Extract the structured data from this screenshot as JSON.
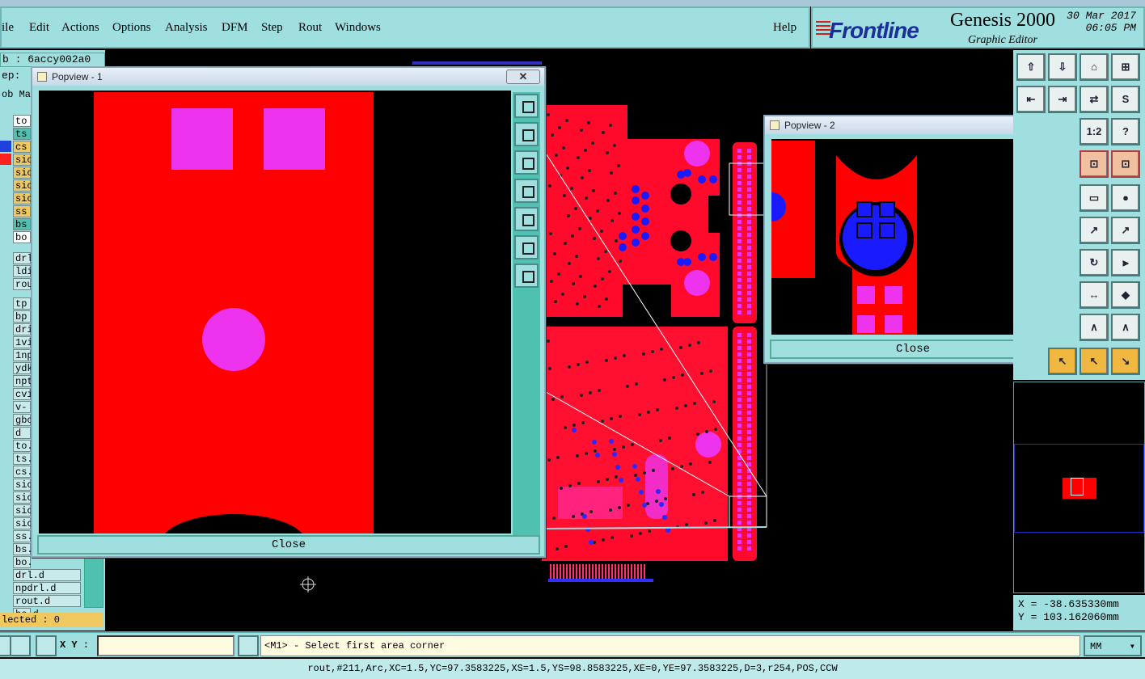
{
  "menu": {
    "items": [
      "ile",
      "Edit",
      "Actions",
      "Options",
      "Analysis",
      "DFM",
      "Step",
      "Rout",
      "Windows"
    ],
    "help": "Help"
  },
  "brand": {
    "logo": "Frontline",
    "product": "Genesis 2000",
    "subtitle": "Graphic Editor",
    "date": "30 Mar 2017",
    "time": "06:05 PM"
  },
  "left": {
    "job": "b : 6accy002a0",
    "step": "ep:",
    "tabs": "ob Ma",
    "layers_top": [
      "to",
      "ts",
      "cs",
      "sic",
      "sic",
      "sic",
      "sic",
      "ss",
      "bs",
      "bo"
    ],
    "layers_drill": [
      "drl",
      "ldi",
      "rou"
    ],
    "layers_rest": [
      "tp",
      "bp",
      "dri",
      "1vi",
      "1np",
      "ydk",
      "npt",
      "cvi",
      "v-c",
      "gbc",
      "d",
      "to.",
      "ts.",
      "cs.",
      "sic",
      "sic",
      "sic",
      "sic",
      "ss.",
      "bs.",
      "bo.",
      "drl.d",
      "npdrl.d",
      "rout.d",
      "bs.d"
    ],
    "selected": "lected : 0",
    "layer_colors": {
      "cs": "#2040e0",
      "sic": "#ff2020"
    }
  },
  "popview1": {
    "title": "Popview - 1",
    "close_x": "✕",
    "close": "Close"
  },
  "popview2": {
    "title": "Popview - 2",
    "close_x": "✕",
    "close": "Close"
  },
  "tools": {
    "ratio": "1:2",
    "help": "?"
  },
  "coords": {
    "x": "X = -38.635330mm",
    "y": "Y = 103.162060mm"
  },
  "cmd": {
    "xy_label": "X Y :",
    "xy_value": "",
    "prompt": "<M1> - Select first area corner",
    "units": "MM"
  },
  "status": "rout,#211,Arc,XC=1.5,YC=97.3583225,XS=1.5,YS=98.8583225,XE=0,YE=97.3583225,D=3,r254,POS,CCW",
  "colors": {
    "copper": "#ff0000",
    "pad": "#ee33ee",
    "drill": "#1a1aff",
    "panel": "#9fdfdf"
  }
}
